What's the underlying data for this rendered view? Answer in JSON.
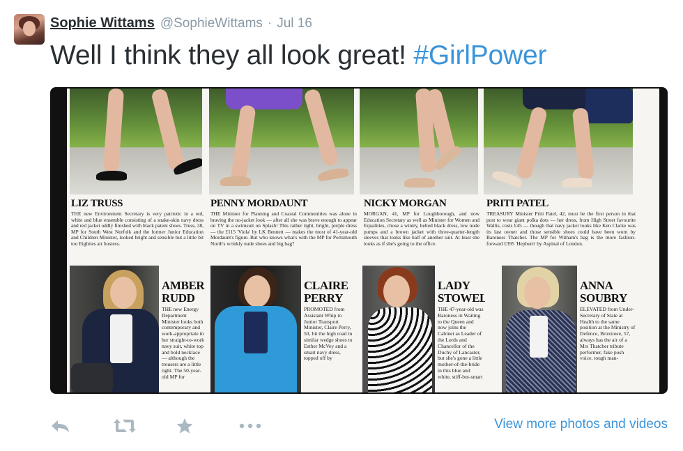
{
  "tweet": {
    "author_name": "Sophie Wittams",
    "handle": "@SophieWittams",
    "separator": "·",
    "date": "Jul 16",
    "text": "Well I think they all look great! ",
    "hashtag": "#GirlPower"
  },
  "media": {
    "top_columns": [
      {
        "name": "LIZ TRUSS",
        "text": "THE new Environment Secretary is very patriotic in a red, white and blue ensemble consisting of a snake-skin navy dress and red jacket oddly finished with black patent shoes. Truss, 38, MP for South West Norfolk and the former Junior Education and Children Minister, looked bright and sensible but a little bit too Eighties air hostess."
      },
      {
        "name": "PENNY MORDAUNT",
        "text": "THE Minister for Planning and Coastal Communities was alone in braving the no-jacket look — after all she was brave enough to appear on TV in a swimsuit on Splash! This rather tight, bright, purple dress — the £115 'Viola' by LK Bennett — makes the most of 41-year-old Mordaunt's figure. But who knows what's with the MP for Portsmouth North's wrinkly nude shoes and big bag?"
      },
      {
        "name": "NICKY MORGAN",
        "text": "MORGAN, 41, MP for Loughborough, and now Education Secretary as well as Minister for Women and Equalities, chose a wintry, belted black dress, low nude pumps and a brown jacket with three-quarter-length sleeves that looks like half of another suit. At least she looks as if she's going to the office."
      },
      {
        "name": "PRITI PATEL",
        "text": "TREASURY Minister Priti Patel, 42, must be the first person in that post to wear giant polka dots — her dress, from High Street favourite Wallis, costs £45 — though that navy jacket looks like Ken Clarke was its last owner and those sensible shoes could have been worn by Baroness Thatcher. The MP for Witham's bag is the more fashion-forward £395 'Hepburn' by Aspinal of London."
      }
    ],
    "bottom_columns": [
      {
        "name_line1": "AMBER",
        "name_line2": "RUDD",
        "text": "THE new Energy Department Minister looks both contemporary and work-appropriate in her straight-to-work navy suit, white top and bold necklace — although the trousers are a little tight. The 50-year-old MP for"
      },
      {
        "name_line1": "CLAIRE",
        "name_line2": "PERRY",
        "text": "PROMOTED from Assistant Whip to Junior Transport Minister, Claire Perry, 50, hit the high road in similar wedge shoes to Esther McVey and a smart navy dress, topped off by"
      },
      {
        "name_line1": "LADY",
        "name_line2": "STOWELL",
        "text": "THE 47-year-old was Baroness in Waiting to the Queen and now joins the Cabinet as Leader of the Lords and Chancellor of the Duchy of Lancaster, but she's gone a little mother-of-the-bride in this blue and white, stiff-but-smart"
      },
      {
        "name_line1": "ANNA",
        "name_line2": "SOUBRY",
        "text": "ELEVATED from Under-Secretary of State at Health to the same position at the Ministry of Defence, Broxtowe, 57, always has the air of a Mrs Thatcher tribute performer, fake posh voice, tough man-"
      }
    ]
  },
  "actions": {
    "reply_icon": "reply-icon",
    "retweet_icon": "retweet-icon",
    "favorite_icon": "star-icon",
    "more_icon": "more-dots-icon",
    "more_link": "View more photos and videos"
  },
  "colors": {
    "link": "#3b94d9",
    "muted": "#8899a6",
    "text": "#292f33"
  }
}
